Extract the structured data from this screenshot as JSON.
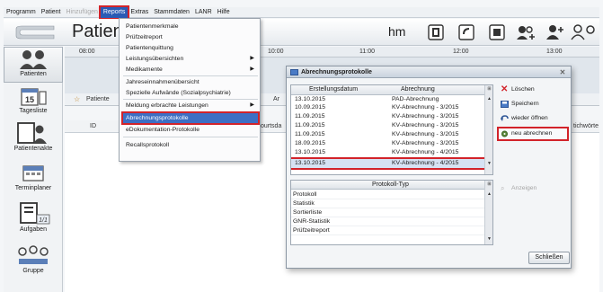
{
  "menubar": {
    "items": [
      "Programm",
      "Patient",
      "Hinzufügen",
      "Reports",
      "Extras",
      "Stammdaten",
      "LANR",
      "Hilfe"
    ]
  },
  "toolbar": {
    "title": "Patient",
    "hm": "hm"
  },
  "timeline": {
    "ticks": [
      "08:00",
      "10:00",
      "11:00",
      "12:00",
      "13:00"
    ]
  },
  "leftnav": {
    "items": [
      "Patienten",
      "Tagesliste",
      "Patientenakte",
      "Terminplaner",
      "Aufgaben",
      "Gruppe"
    ],
    "calendar_day": "15",
    "tasks_badge": "1/1"
  },
  "patient_area": {
    "tab_label": "Patiente",
    "col_id": "ID",
    "col_birth": "ourtsda",
    "col_keyword": "tichwörte",
    "col_ar": "Ar"
  },
  "reports_menu": {
    "items": [
      {
        "label": "Patientenmerkmale",
        "submenu": false
      },
      {
        "label": "Prüfzeitreport",
        "submenu": false
      },
      {
        "label": "Patientenquittung",
        "submenu": false
      },
      {
        "label": "Leistungsübersichten",
        "submenu": true
      },
      {
        "label": "Medikamente",
        "submenu": true
      },
      {
        "label": "Jahreseinnahmenübersicht",
        "submenu": false
      },
      {
        "label": "Spezielle Aufwände (Sozialpsychiatrie)",
        "submenu": false
      },
      {
        "label": "Meldung erbrachte Leistungen",
        "submenu": true
      },
      {
        "label": "Abrechnungsprotokolle",
        "submenu": false
      },
      {
        "label": "eDokumentation-Protokolle",
        "submenu": false
      },
      {
        "label": "Recallsprotokoll",
        "submenu": false
      }
    ]
  },
  "dialog": {
    "title": "Abrechnungsprotokolle",
    "list1": {
      "col_date": "Erstellungsdatum",
      "col_billing": "Abrechnung",
      "rows": [
        {
          "date": "13.10.2015",
          "billing": "PAD-Abrechnung"
        },
        {
          "date": "10.09.2015",
          "billing": "KV-Abrechnung - 3/2015"
        },
        {
          "date": "11.09.2015",
          "billing": "KV-Abrechnung - 3/2015"
        },
        {
          "date": "11.09.2015",
          "billing": "KV-Abrechnung - 3/2015"
        },
        {
          "date": "11.09.2015",
          "billing": "KV-Abrechnung - 3/2015"
        },
        {
          "date": "18.09.2015",
          "billing": "KV-Abrechnung - 3/2015"
        },
        {
          "date": "13.10.2015",
          "billing": "KV-Abrechnung - 4/2015"
        },
        {
          "date": "13.10.2015",
          "billing": "KV-Abrechnung - 4/2015"
        }
      ]
    },
    "list2": {
      "col_type": "Protokoll-Typ",
      "rows": [
        "Protokoll",
        "Statistik",
        "Sortierliste",
        "GNR-Statistik",
        "Prüfzeitreport"
      ]
    },
    "buttons": {
      "delete": "Löschen",
      "save": "Speichern",
      "reopen": "wieder öffnen",
      "recalc": "neu abrechnen",
      "show": "Anzeigen",
      "close": "Schließen"
    }
  }
}
